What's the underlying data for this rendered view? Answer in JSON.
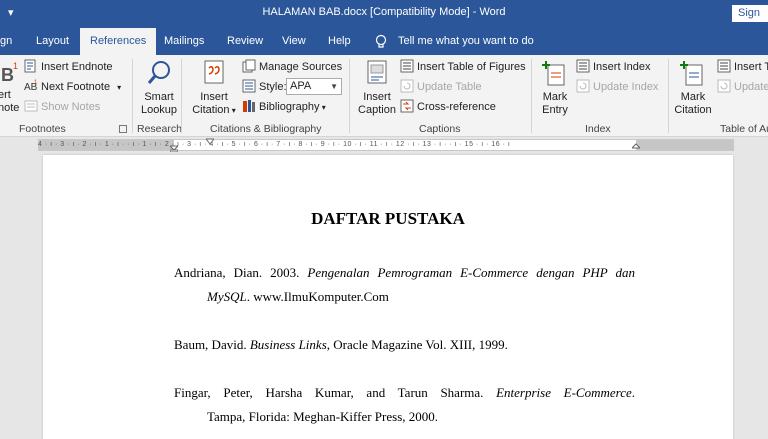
{
  "titlebar": {
    "title": "HALAMAN BAB.docx [Compatibility Mode]  -  Word",
    "signin": "Sign in"
  },
  "tabs": [
    {
      "label": "gn"
    },
    {
      "label": "Layout"
    },
    {
      "label": "References",
      "active": true
    },
    {
      "label": "Mailings"
    },
    {
      "label": "Review"
    },
    {
      "label": "View"
    },
    {
      "label": "Help"
    }
  ],
  "tell_me": "Tell me what you want to do",
  "ribbon": {
    "footnotes": {
      "insert_footnote_partial": "ert",
      "insert_footnote_partial2": "note",
      "insert_endnote": "Insert Endnote",
      "next_footnote": "Next Footnote",
      "show_notes": "Show Notes",
      "label": "Footnotes"
    },
    "research": {
      "smart_lookup_1": "Smart",
      "smart_lookup_2": "Lookup",
      "label": "Research"
    },
    "citations": {
      "insert_citation_1": "Insert",
      "insert_citation_2": "Citation",
      "manage_sources": "Manage Sources",
      "style_label": "Style:",
      "style_value": "APA",
      "bibliography": "Bibliography",
      "label": "Citations & Bibliography"
    },
    "captions": {
      "insert_caption_1": "Insert",
      "insert_caption_2": "Caption",
      "insert_table_of_figures": "Insert Table of Figures",
      "update_table": "Update Table",
      "cross_reference": "Cross-reference",
      "label": "Captions"
    },
    "index": {
      "mark_entry_1": "Mark",
      "mark_entry_2": "Entry",
      "insert_index": "Insert Index",
      "update_index": "Update Index",
      "label": "Index"
    },
    "toa": {
      "mark_citation_1": "Mark",
      "mark_citation_2": "Citation",
      "insert_table": "Insert Ta",
      "update": "Update",
      "label": "Table of Au"
    }
  },
  "ruler": {
    "text": "4 · ı · 3 · ı · 2 · ı · 1 · ı ·   · ı · 1 · ı · 2 · ı · 3 · ı · 4 · ı · 5 · ı · 6 · ı · 7 · ı · 8 · ı · 9 · ı · 10 · ı · 11 · ı · 12 · ı · 13 · ı ·   · ı · 15 · ı · 16 · ı"
  },
  "document": {
    "heading": "DAFTAR PUSTAKA",
    "references": [
      {
        "line1_plain": "Andriana, Dian. 2003. ",
        "line1_italic": "Pengenalan Pemrograman E-Commerce dengan PHP dan",
        "line2_italic": "MySQL",
        "line2_plain": ". www.IlmuKomputer.Com"
      },
      {
        "line1_plain": "Baum, David. ",
        "line1_italic": "Business Links",
        "line1_tail": ", Oracle Magazine Vol. XIII, 1999."
      },
      {
        "line1_plain": "Fingar, Peter, Harsha Kumar, and Tarun Sharma. ",
        "line1_italic": "Enterprise E-Commerce",
        "line1_tail": ".",
        "line2_plain": "Tampa, Florida: Meghan-Kiffer Press, 2000."
      }
    ]
  },
  "colors": {
    "word_blue": "#2b579a",
    "ribbon_bg": "#f3f3f3",
    "canvas_bg": "#e6e6e6"
  }
}
